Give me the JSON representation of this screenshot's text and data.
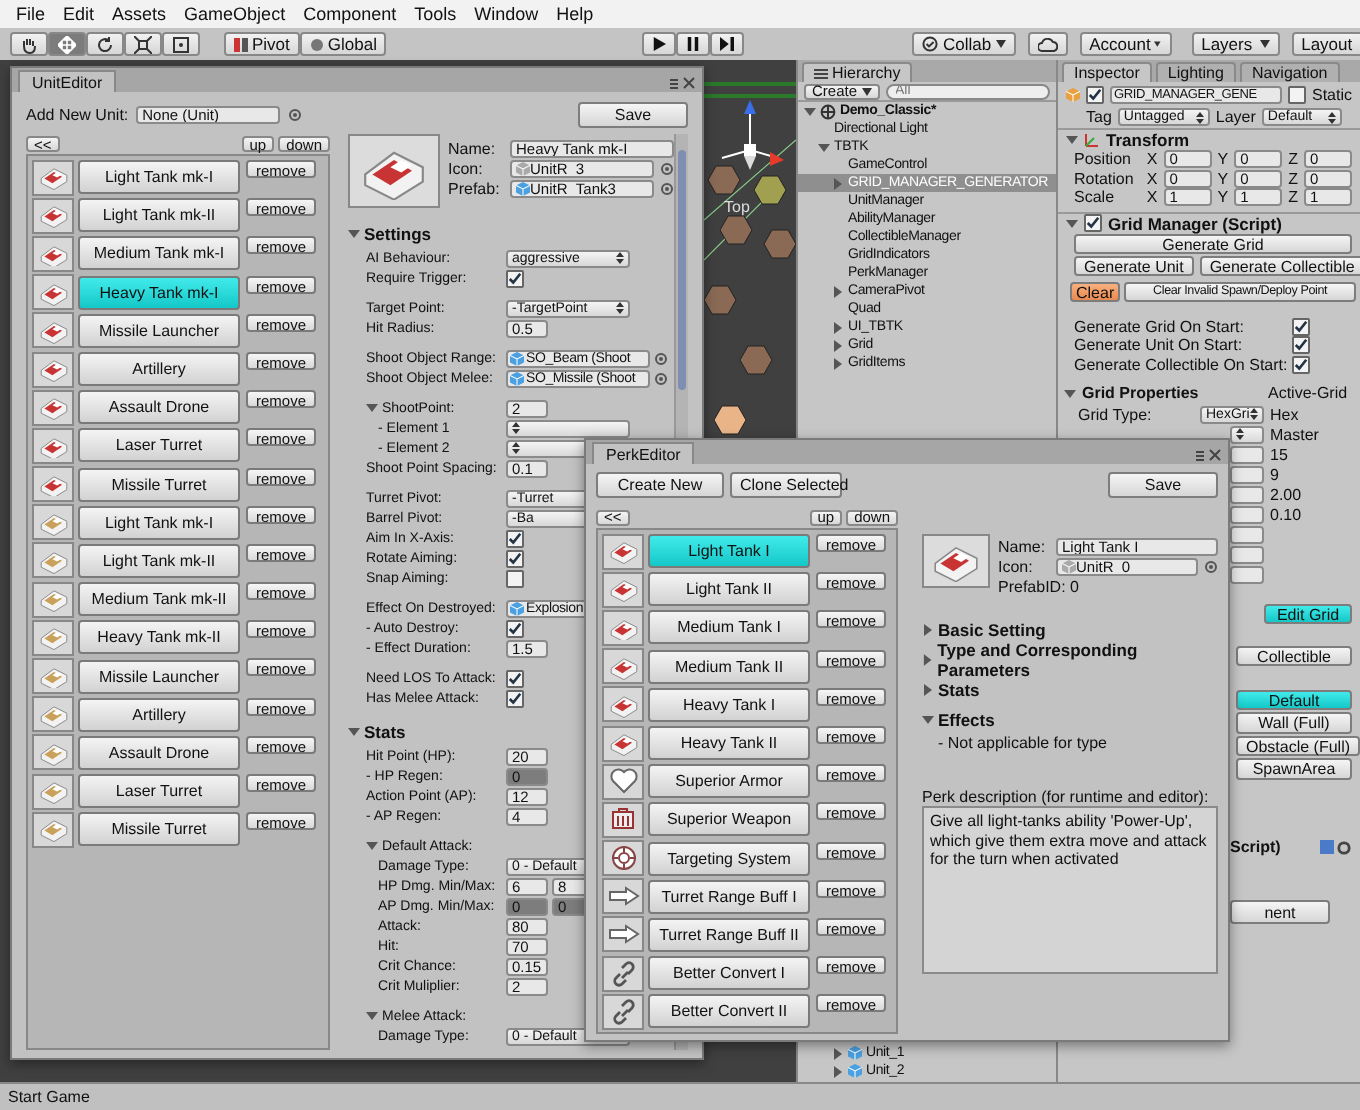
{
  "menu": [
    "File",
    "Edit",
    "Assets",
    "GameObject",
    "Component",
    "Tools",
    "Window",
    "Help"
  ],
  "toolbar": {
    "tools": [
      {
        "kind": "hand",
        "selected": false
      },
      {
        "kind": "move",
        "selected": true
      },
      {
        "kind": "rotate",
        "selected": false
      },
      {
        "kind": "scale",
        "selected": false
      },
      {
        "kind": "rect",
        "selected": false
      }
    ],
    "pivot": "Pivot",
    "space": "Global",
    "playback": [
      {
        "kind": "play",
        "selected": false
      },
      {
        "kind": "pause",
        "selected": false
      },
      {
        "kind": "step",
        "selected": false
      }
    ],
    "collab": "Collab",
    "account": "Account",
    "layers": "Layers",
    "layout": "Layout"
  },
  "scene": {
    "label": "Top"
  },
  "hierarchy": {
    "title": "Hierarchy",
    "create": "Create",
    "search_placeholder": "All",
    "tree": [
      {
        "kind": "scene",
        "label": "Demo_Classic*",
        "expanded": true,
        "selected": false,
        "children": [
          {
            "label": "Directional Light",
            "selected": false
          },
          {
            "label": "TBTK",
            "expanded": true,
            "selected": false,
            "children": [
              {
                "label": "GameControl",
                "selected": false
              },
              {
                "label": "GRID_MANAGER_GENERATOR",
                "expanded": false,
                "selected": true
              },
              {
                "label": "UnitManager",
                "selected": false
              },
              {
                "label": "AbilityManager",
                "selected": false
              },
              {
                "label": "CollectibleManager",
                "selected": false
              },
              {
                "label": "GridIndicators",
                "selected": false
              },
              {
                "label": "PerkManager",
                "selected": false
              },
              {
                "label": "CameraPivot",
                "expanded": false,
                "selected": false
              },
              {
                "label": "Quad",
                "selected": false
              },
              {
                "label": "UI_TBTK",
                "expanded": false,
                "selected": false
              },
              {
                "label": "Grid",
                "expanded": false,
                "selected": false
              },
              {
                "label": "GridItems",
                "expanded": false,
                "selected": false
              }
            ]
          }
        ]
      }
    ],
    "lower_items": [
      {
        "label": "Unit_1",
        "expanded": false,
        "selected": false
      },
      {
        "label": "Unit_2",
        "expanded": false,
        "selected": false
      }
    ]
  },
  "inspector": {
    "tabs": [
      {
        "label": "Inspector",
        "selected": true
      },
      {
        "label": "Lighting",
        "selected": false
      },
      {
        "label": "Navigation",
        "selected": false
      }
    ],
    "object": {
      "active": true,
      "name": "GRID_MANAGER_GENE",
      "static_label": "Static",
      "static": false,
      "tag_label": "Tag",
      "tag": "Untagged",
      "layer_label": "Layer",
      "layer": "Default"
    },
    "transform": {
      "title": "Transform",
      "expanded": true,
      "rows": [
        {
          "label": "Position",
          "values": [
            {
              "axis": "X",
              "value": "0"
            },
            {
              "axis": "Y",
              "value": "0"
            },
            {
              "axis": "Z",
              "value": "0"
            }
          ]
        },
        {
          "label": "Rotation",
          "values": [
            {
              "axis": "X",
              "value": "0"
            },
            {
              "axis": "Y",
              "value": "0"
            },
            {
              "axis": "Z",
              "value": "0"
            }
          ]
        },
        {
          "label": "Scale",
          "values": [
            {
              "axis": "X",
              "value": "1"
            },
            {
              "axis": "Y",
              "value": "1"
            },
            {
              "axis": "Z",
              "value": "1"
            }
          ]
        }
      ]
    },
    "script": {
      "title": "Grid Manager (Script)",
      "expanded": true,
      "enabled": true,
      "button_rows": [
        [
          "Generate Grid"
        ],
        [
          "Generate Unit",
          "Generate Collectible"
        ]
      ],
      "clear_buttons": [
        {
          "label": "Clear",
          "highlight": true
        },
        {
          "label": "Clear Invalid Spawn/Deploy Point",
          "highlight": false
        }
      ],
      "toggles": [
        {
          "label": "Generate Grid On Start:",
          "checked": true
        },
        {
          "label": "Generate Unit On Start:",
          "checked": true
        },
        {
          "label": "Generate Collectible On Start:",
          "checked": true
        }
      ],
      "grid_properties": {
        "title": "Grid Properties",
        "expanded": true,
        "note": "Active-Grid",
        "grid_type_label": "Grid Type:",
        "grid_type": "HexGri",
        "grid_type_note": "Hex",
        "values": [
          {
            "kind": "select",
            "text": "Master"
          },
          {
            "kind": "field",
            "text": "15"
          },
          {
            "kind": "field",
            "text": "9"
          },
          {
            "kind": "field",
            "text": "2.00"
          },
          {
            "kind": "field",
            "text": "0.10"
          },
          {
            "kind": "field"
          },
          {
            "kind": "field"
          },
          {
            "kind": "field"
          }
        ]
      },
      "edit_grid": {
        "label": "Edit Grid",
        "selected": true
      },
      "collectible": "Collectible",
      "tile_types": [
        {
          "label": "Default",
          "selected": true
        },
        {
          "label": "Wall (Full)",
          "selected": false
        },
        {
          "label": "Obstacle (Full)",
          "selected": false
        },
        {
          "label": "SpawnArea",
          "selected": false
        }
      ]
    },
    "next_component": "Script)",
    "add_component": "nent"
  },
  "unit_editor": {
    "title": "UnitEditor",
    "add_label": "Add New Unit:",
    "add_value": "None (Unit)",
    "save": "Save",
    "back": "<<",
    "up": "up",
    "down": "down",
    "units": [
      {
        "name": "Light Tank mk-I",
        "color": "#c83434",
        "selected": false,
        "remove": "remove"
      },
      {
        "name": "Light Tank mk-II",
        "color": "#c83434",
        "selected": false,
        "remove": "remove"
      },
      {
        "name": "Medium Tank mk-I",
        "color": "#c83434",
        "selected": false,
        "remove": "remove"
      },
      {
        "name": "Heavy Tank mk-I",
        "color": "#c83434",
        "selected": true,
        "remove": "remove"
      },
      {
        "name": "Missile Launcher",
        "color": "#c83434",
        "selected": false,
        "remove": "remove"
      },
      {
        "name": "Artillery",
        "color": "#c83434",
        "selected": false,
        "remove": "remove"
      },
      {
        "name": "Assault Drone",
        "color": "#c83434",
        "selected": false,
        "remove": "remove"
      },
      {
        "name": "Laser Turret",
        "color": "#c83434",
        "selected": false,
        "remove": "remove"
      },
      {
        "name": "Missile Turret",
        "color": "#c83434",
        "selected": false,
        "remove": "remove"
      },
      {
        "name": "Light Tank mk-I",
        "color": "#c9a15a",
        "selected": false,
        "remove": "remove"
      },
      {
        "name": "Light Tank mk-II",
        "color": "#c9a15a",
        "selected": false,
        "remove": "remove"
      },
      {
        "name": "Medium Tank mk-II",
        "color": "#c9a15a",
        "selected": false,
        "remove": "remove"
      },
      {
        "name": "Heavy Tank mk-II",
        "color": "#c9a15a",
        "selected": false,
        "remove": "remove"
      },
      {
        "name": "Missile Launcher",
        "color": "#c9a15a",
        "selected": false,
        "remove": "remove"
      },
      {
        "name": "Artillery",
        "color": "#c9a15a",
        "selected": false,
        "remove": "remove"
      },
      {
        "name": "Assault Drone",
        "color": "#c9a15a",
        "selected": false,
        "remove": "remove"
      },
      {
        "name": "Laser Turret",
        "color": "#c9a15a",
        "selected": false,
        "remove": "remove"
      },
      {
        "name": "Missile Turret",
        "color": "#c9a15a",
        "selected": false,
        "remove": "remove"
      }
    ],
    "detail": {
      "name_label": "Name:",
      "name": "Heavy Tank mk-I",
      "icon_label": "Icon:",
      "icon": "UnitR_3",
      "prefab_label": "Prefab:",
      "prefab": "UnitR_Tank3",
      "sections": [
        {
          "title": "Settings",
          "expanded": true,
          "blocks": [
            [
              {
                "kind": "select",
                "label": "AI Behaviour:",
                "value": "aggressive"
              },
              {
                "kind": "check",
                "label": "Require Trigger:",
                "checked": true
              }
            ],
            [
              {
                "kind": "select",
                "label": "Target Point:",
                "value": "-TargetPoint"
              },
              {
                "kind": "field",
                "label": "Hit Radius:",
                "value": "0.5",
                "disabled": false
              }
            ],
            [
              {
                "kind": "object",
                "label": "Shoot Object Range:",
                "value": "SO_Beam (Shoot"
              },
              {
                "kind": "object",
                "label": "Shoot Object Melee:",
                "value": "SO_Missile (Shoot"
              }
            ],
            [
              {
                "kind": "group",
                "label": "ShootPoint:",
                "expanded": true,
                "value": "2",
                "rows": [
                  {
                    "kind": "select",
                    "label": "- Element 1"
                  },
                  {
                    "kind": "select",
                    "label": "- Element 2"
                  }
                ]
              },
              {
                "kind": "field",
                "label": "Shoot Point Spacing:",
                "value": "0.1",
                "disabled": false
              }
            ],
            [
              {
                "kind": "select",
                "label": "Turret Pivot:",
                "value": "-Turret"
              },
              {
                "kind": "select",
                "label": "Barrel Pivot:",
                "value": "-Ba"
              },
              {
                "kind": "check",
                "label": "Aim In X-Axis:",
                "checked": true
              },
              {
                "kind": "check",
                "label": "Rotate Aiming:",
                "checked": true
              },
              {
                "kind": "check",
                "label": "Snap Aiming:",
                "checked": false
              }
            ],
            [
              {
                "kind": "object",
                "label": "Effect On Destroyed:",
                "value": "Explosion"
              },
              {
                "kind": "check",
                "label": "- Auto Destroy:",
                "checked": true
              },
              {
                "kind": "field",
                "label": "- Effect Duration:",
                "value": "1.5",
                "disabled": false
              }
            ],
            [
              {
                "kind": "check",
                "label": "Need LOS To Attack:",
                "checked": true
              },
              {
                "kind": "check",
                "label": "Has Melee Attack:",
                "checked": true
              }
            ]
          ]
        },
        {
          "title": "Stats",
          "expanded": true,
          "blocks": [
            [
              {
                "kind": "field",
                "label": "Hit Point (HP):",
                "value": "20",
                "disabled": false
              },
              {
                "kind": "field",
                "label": "- HP Regen:",
                "value": "0",
                "disabled": true
              },
              {
                "kind": "field",
                "label": "Action Point (AP):",
                "value": "12",
                "disabled": false
              },
              {
                "kind": "field",
                "label": "- AP Regen:",
                "value": "4",
                "disabled": false
              }
            ],
            [
              {
                "kind": "group",
                "label": "Default Attack:",
                "expanded": true,
                "rows": [
                  {
                    "kind": "select",
                    "label": "Damage Type:",
                    "value": "0 - Default"
                  },
                  {
                    "kind": "pair",
                    "label": "HP Dmg. Min/Max:",
                    "values": [
                      "6",
                      "8"
                    ],
                    "disabled": false
                  },
                  {
                    "kind": "pair",
                    "label": "AP Dmg. Min/Max:",
                    "values": [
                      "0",
                      "0"
                    ],
                    "disabled": true
                  },
                  {
                    "kind": "field",
                    "label": "Attack:",
                    "value": "80",
                    "disabled": false
                  },
                  {
                    "kind": "field",
                    "label": "Hit:",
                    "value": "70",
                    "disabled": false
                  },
                  {
                    "kind": "field",
                    "label": "Crit Chance:",
                    "value": "0.15",
                    "disabled": false
                  },
                  {
                    "kind": "field",
                    "label": "Crit Muliplier:",
                    "value": "2",
                    "disabled": false
                  }
                ]
              }
            ],
            [
              {
                "kind": "group",
                "label": "Melee Attack:",
                "expanded": true,
                "rows": [
                  {
                    "kind": "select",
                    "label": "Damage Type:",
                    "value": "0 - Default"
                  }
                ]
              }
            ]
          ]
        }
      ]
    }
  },
  "perk_editor": {
    "title": "PerkEditor",
    "create": "Create New",
    "clone": "Clone Selected",
    "save": "Save",
    "back": "<<",
    "up": "up",
    "down": "down",
    "perks": [
      {
        "name": "Light Tank I",
        "kind": "tank",
        "selected": true,
        "remove": "remove"
      },
      {
        "name": "Light Tank II",
        "kind": "tank",
        "selected": false,
        "remove": "remove"
      },
      {
        "name": "Medium Tank I",
        "kind": "tank",
        "selected": false,
        "remove": "remove"
      },
      {
        "name": "Medium Tank II",
        "kind": "tank",
        "selected": false,
        "remove": "remove"
      },
      {
        "name": "Heavy Tank I",
        "kind": "tank",
        "selected": false,
        "remove": "remove"
      },
      {
        "name": "Heavy Tank II",
        "kind": "tank",
        "selected": false,
        "remove": "remove"
      },
      {
        "name": "Superior Armor",
        "kind": "heart",
        "selected": false,
        "remove": "remove"
      },
      {
        "name": "Superior Weapon",
        "kind": "crate",
        "selected": false,
        "remove": "remove"
      },
      {
        "name": "Targeting System",
        "kind": "target",
        "selected": false,
        "remove": "remove"
      },
      {
        "name": "Turret Range Buff I",
        "kind": "arrow",
        "selected": false,
        "remove": "remove"
      },
      {
        "name": "Turret Range Buff II",
        "kind": "arrow",
        "selected": false,
        "remove": "remove"
      },
      {
        "name": "Better Convert I",
        "kind": "link",
        "selected": false,
        "remove": "remove"
      },
      {
        "name": "Better Convert II",
        "kind": "link",
        "selected": false,
        "remove": "remove"
      }
    ],
    "detail": {
      "name_label": "Name:",
      "name": "Light Tank I",
      "icon_label": "Icon:",
      "icon": "UnitR_0",
      "prefab_id": "PrefabID: 0",
      "sections": [
        {
          "title": "Basic Setting",
          "expanded": false
        },
        {
          "title": "Type and Corresponding Parameters",
          "expanded": false
        },
        {
          "title": "Stats",
          "expanded": false
        },
        {
          "title": "Effects",
          "expanded": true,
          "note": "- Not applicable for type"
        }
      ],
      "description_label": "Perk description (for runtime and editor):",
      "description": "Give all light-tanks ability 'Power-Up', which give them extra move and attack for the turn when activated"
    }
  },
  "status_bar": {
    "message": "Start Game"
  }
}
